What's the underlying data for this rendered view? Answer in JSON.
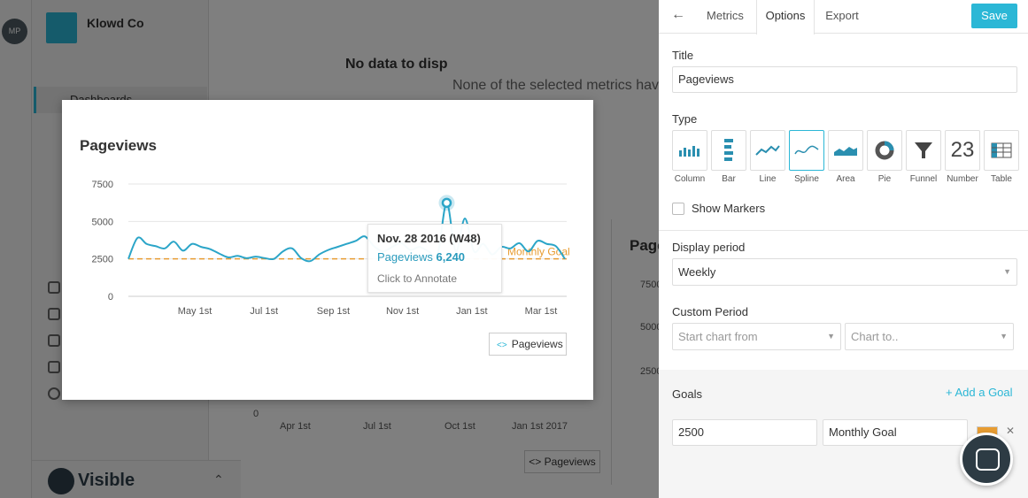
{
  "background": {
    "avatar_initials": "MP",
    "company_name": "Klowd Co",
    "sidebar_item": "Dashboards",
    "nodata_title": "No data to disp",
    "nodata_subtitle": "None of the selected metrics hav",
    "card_title": "Page",
    "card_y_ticks": [
      "7500",
      "5000",
      "2500",
      "0"
    ],
    "x_ticks": [
      "Apr 1st",
      "Jul 1st",
      "Oct 1st",
      "Jan 1st 2017"
    ],
    "legend_label": "Pageviews",
    "brand": "Visible"
  },
  "modal": {
    "title": "Pageviews",
    "legend_label": "Pageviews",
    "tooltip": {
      "date": "Nov. 28 2016 (W48)",
      "series": "Pageviews",
      "value": "6,240",
      "hint": "Click to Annotate"
    }
  },
  "chart_data": {
    "type": "line",
    "title": "Pageviews",
    "xlabel": "",
    "ylabel": "",
    "ylim": [
      0,
      7500
    ],
    "y_ticks": [
      "7500",
      "5000",
      "2500",
      "0"
    ],
    "x_ticks": [
      "May 1st",
      "Jul 1st",
      "Sep 1st",
      "Nov 1st",
      "Jan 1st",
      "Mar 1st"
    ],
    "grid": true,
    "series": [
      {
        "name": "Pageviews",
        "color": "#2ba5c8",
        "values": [
          2500,
          3900,
          3500,
          3350,
          3200,
          3650,
          3050,
          3500,
          3300,
          3150,
          2850,
          2600,
          2700,
          2550,
          2650,
          2550,
          2500,
          3000,
          3200,
          2550,
          2350,
          2800,
          3100,
          3300,
          3500,
          3700,
          4000,
          3350,
          3000,
          3300,
          3550,
          3100,
          3300,
          3000,
          2800,
          6240,
          3000,
          5200,
          3000,
          3500,
          2800,
          3300,
          3200,
          3550,
          3000,
          3700,
          3500,
          3350,
          2500
        ]
      }
    ],
    "goal": {
      "name": "Monthly Goal",
      "value": 2500,
      "color": "#e79c32"
    },
    "highlight_index": 35
  },
  "panel": {
    "tabs": [
      "Metrics",
      "Options",
      "Export"
    ],
    "active_tab": "Options",
    "save_label": "Save",
    "title_label": "Title",
    "title_value": "Pageviews",
    "type_label": "Type",
    "types": [
      "Column",
      "Bar",
      "Line",
      "Spline",
      "Area",
      "Pie",
      "Funnel",
      "Number",
      "Table"
    ],
    "selected_type": "Spline",
    "number_glyph": "23",
    "show_markers_label": "Show Markers",
    "display_period_label": "Display period",
    "display_period_value": "Weekly",
    "custom_period_label": "Custom Period",
    "start_placeholder": "Start chart from",
    "end_placeholder": "Chart to..",
    "goals_label": "Goals",
    "add_goal_label": "+ Add a Goal",
    "goal_value": "2500",
    "goal_name": "Monthly Goal",
    "accent": "#2bb7d6"
  }
}
